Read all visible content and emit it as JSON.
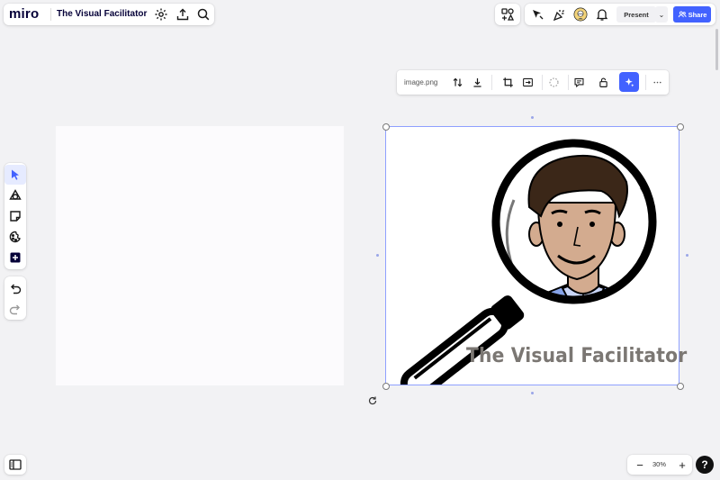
{
  "app": {
    "logo": "miro",
    "board_title": "The Visual Facilitator"
  },
  "top_left_icons": [
    "gear-icon",
    "upload-icon",
    "search-icon"
  ],
  "top_right": {
    "present_label": "Present",
    "share_label": "Share",
    "caret": "⌄"
  },
  "left_toolbar": {
    "tools": [
      "select-tool",
      "shapes-tool",
      "sticky-note-tool",
      "templates-tool",
      "add-more-tool"
    ],
    "active": "select-tool",
    "history": [
      "undo",
      "redo"
    ]
  },
  "context_toolbar": {
    "filename": "image.png"
  },
  "canvas_image": {
    "caption": "The Visual Facilitator"
  },
  "zoom": {
    "level": "30%",
    "minus": "−",
    "plus": "+"
  },
  "help": {
    "label": "?"
  },
  "colors": {
    "accent": "#4262ff",
    "canvas": "#f2f2f4",
    "selection": "#8fa0ff",
    "caption": "#7b7773"
  }
}
